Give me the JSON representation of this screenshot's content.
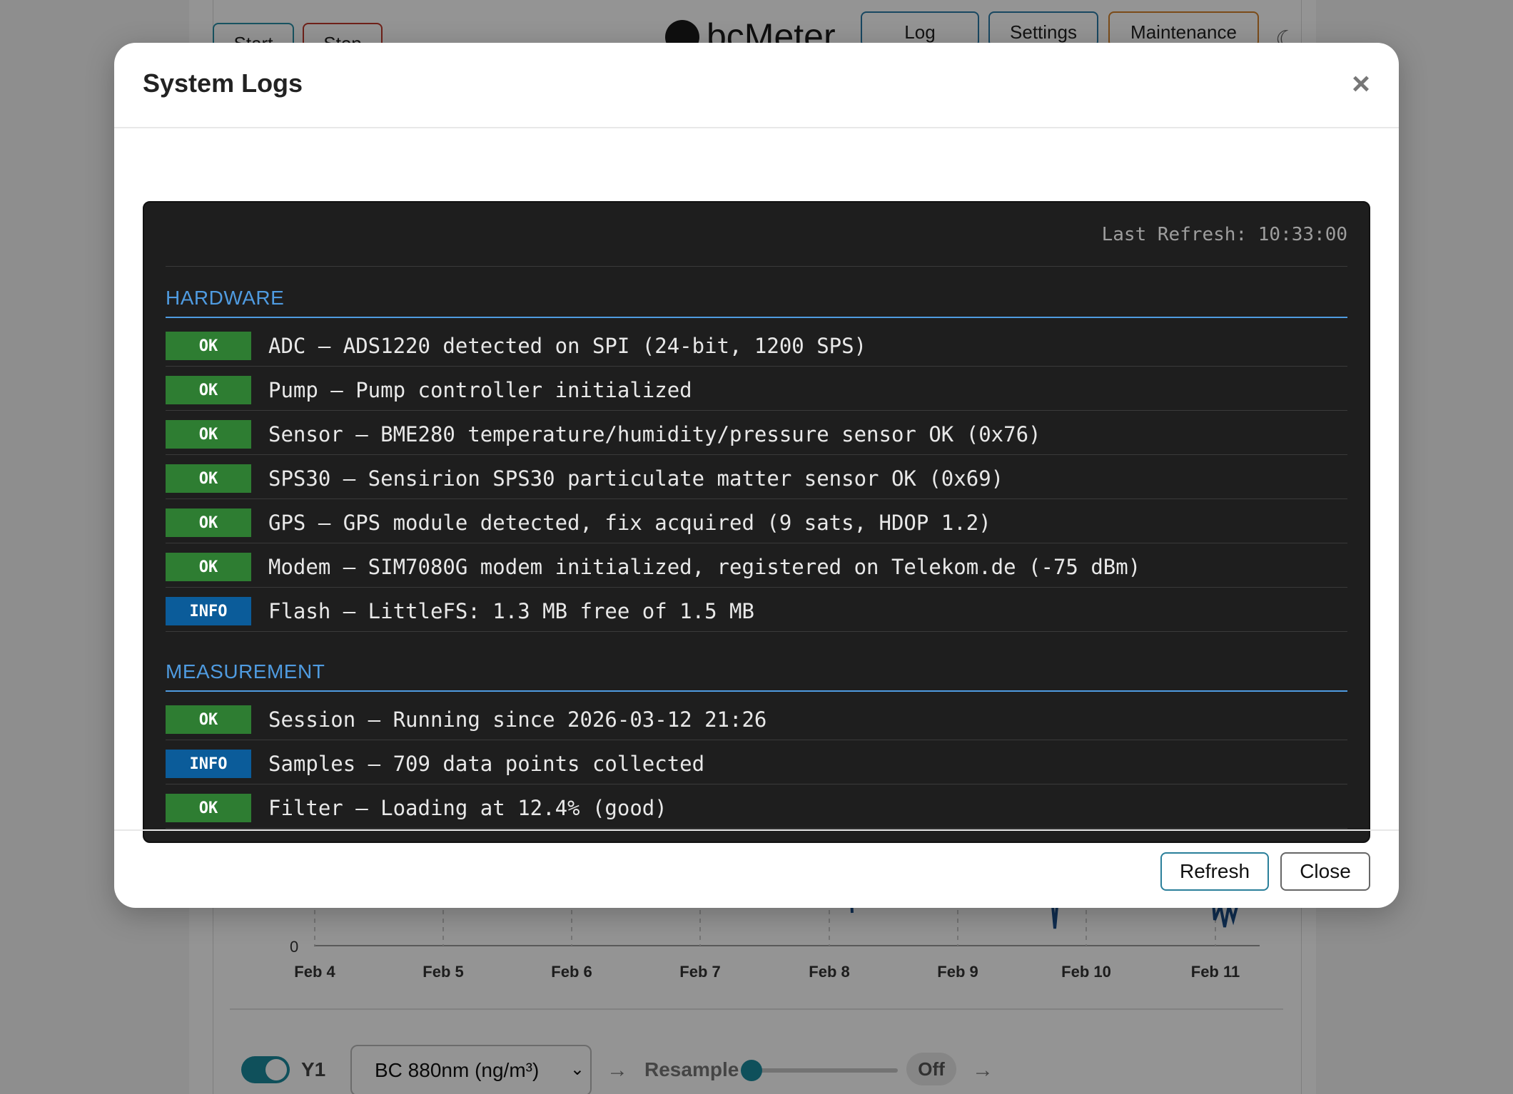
{
  "background": {
    "toolbar": {
      "start_label": "Start",
      "stop_label": "Stop",
      "brand": "bcMeter",
      "log_label": "Log",
      "settings_label": "Settings",
      "maintenance_label": "Maintenance"
    },
    "chart": {
      "y_zero_label": "0",
      "x_ticks": [
        "Feb 4",
        "Feb 5",
        "Feb 6",
        "Feb 7",
        "Feb 8",
        "Feb 9",
        "Feb 10",
        "Feb 11"
      ]
    },
    "controls": {
      "y1_label": "Y1",
      "series_select_value": "BC 880nm (ng/m³)",
      "resample_label": "Resample",
      "resample_value": "Off"
    }
  },
  "modal": {
    "title": "System Logs",
    "close_glyph": "×",
    "last_refresh": "Last Refresh: 10:33:00",
    "sections": [
      {
        "title": "HARDWARE",
        "rows": [
          {
            "status": "OK",
            "text": "ADC — ADS1220 detected on SPI (24-bit, 1200 SPS)"
          },
          {
            "status": "OK",
            "text": "Pump — Pump controller initialized"
          },
          {
            "status": "OK",
            "text": "Sensor — BME280 temperature/humidity/pressure sensor OK (0x76)"
          },
          {
            "status": "OK",
            "text": "SPS30 — Sensirion SPS30 particulate matter sensor OK (0x69)"
          },
          {
            "status": "OK",
            "text": "GPS — GPS module detected, fix acquired (9 sats, HDOP 1.2)"
          },
          {
            "status": "OK",
            "text": "Modem — SIM7080G modem initialized, registered on Telekom.de (-75 dBm)"
          },
          {
            "status": "INFO",
            "text": "Flash — LittleFS: 1.3 MB free of 1.5 MB"
          }
        ]
      },
      {
        "title": "MEASUREMENT",
        "rows": [
          {
            "status": "OK",
            "text": "Session — Running since 2026-03-12 21:26"
          },
          {
            "status": "INFO",
            "text": "Samples — 709 data points collected"
          },
          {
            "status": "OK",
            "text": "Filter — Loading at 12.4% (good)"
          }
        ]
      }
    ],
    "footer": {
      "refresh_label": "Refresh",
      "close_label": "Close"
    }
  },
  "colors": {
    "ok_badge": "#2e7d32",
    "info_badge": "#0b5c9a",
    "section_title": "#4f9be0",
    "log_background": "#1e1e1e"
  }
}
